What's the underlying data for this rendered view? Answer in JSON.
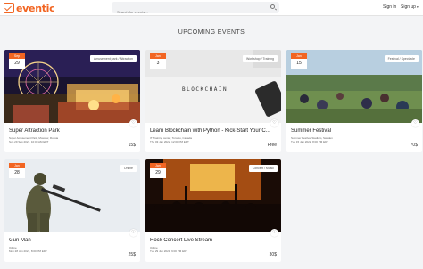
{
  "app": {
    "logo_text": "eventic"
  },
  "header": {
    "search_placeholder": "Search for events...",
    "sign_in": "Sign in",
    "sign_up": "Sign up",
    "sign_up_caret": "▾"
  },
  "page": {
    "heading": "UPCOMING EVENTS"
  },
  "colors": {
    "accent": "#f26522"
  },
  "events": [
    {
      "month": "Sep",
      "day": "29",
      "category": "Amusement park / Attraction",
      "title": "Super Attraction Park",
      "location": "Super Amusement Park, Moscow, Russia",
      "date": "Sun 29 Sep 2021, 10:00 AM EDT",
      "price": "15$"
    },
    {
      "month": "Jan",
      "day": "3",
      "category": "Workshop / Training",
      "title": "Learn Blockchain with Python - Kick-Start Your C...",
      "location": "IT Training center, Toronto, Canada",
      "date": "Thu 03 Jan 2022, 12:00 PM EDT",
      "price": "Free"
    },
    {
      "month": "Jan",
      "day": "15",
      "category": "Festival / Spectacle",
      "title": "Summer Festival",
      "location": "Summer Festival Stadium, Sweden",
      "date": "Tue 15 Jan 2022, 8:00 PM EDT",
      "price": "70$"
    },
    {
      "month": "Jan",
      "day": "28",
      "category": "Online",
      "title": "Gun Man",
      "location": "Online",
      "date": "Mon 28 Jan 2021, 8:00 PM EDT",
      "price": "25$"
    },
    {
      "month": "Jan",
      "day": "29",
      "category": "Concert / Music",
      "title": "Rock Concert Live Stream",
      "location": "Online",
      "date": "Tue 29 Jun 2021, 9:00 PM EDT",
      "price": "30$"
    }
  ]
}
